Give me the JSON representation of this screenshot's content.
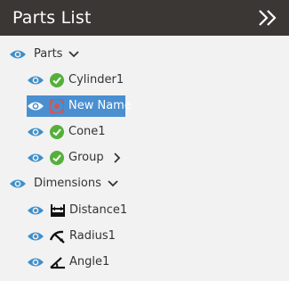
{
  "header": {
    "title": "Parts List",
    "collapse_icon": "double-chevron-right-icon"
  },
  "colors": {
    "header_bg": "#3a3734",
    "panel_bg": "#f2f2f2",
    "selection": "#4a8fd0",
    "eye": "#3d8fca",
    "check": "#55b03a",
    "error_icon": "#d9534f"
  },
  "tree": {
    "parts": {
      "label": "Parts",
      "expanded": true,
      "items": [
        {
          "label": "Cylinder1",
          "status": "check-icon"
        },
        {
          "label": "New Name",
          "status": "error-icon",
          "selected": true
        },
        {
          "label": "Cone1",
          "status": "check-icon"
        },
        {
          "label": "Group",
          "status": "check-icon",
          "expandable": true
        }
      ]
    },
    "dimensions": {
      "label": "Dimensions",
      "expanded": true,
      "items": [
        {
          "label": "Distance1",
          "icon": "distance-dimension-icon"
        },
        {
          "label": "Radius1",
          "icon": "radius-dimension-icon"
        },
        {
          "label": "Angle1",
          "icon": "angle-dimension-icon"
        }
      ]
    }
  }
}
